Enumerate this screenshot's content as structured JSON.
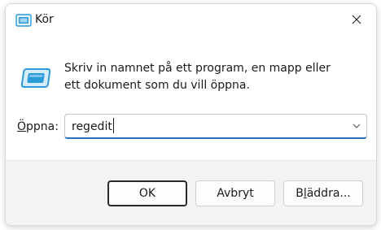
{
  "window": {
    "title": "Kör",
    "title_icon": "run-dialog-icon",
    "close_icon": "close-icon"
  },
  "body": {
    "icon": "run-program-icon",
    "description": "Skriv in namnet på ett program, en mapp eller ett dokument som du vill öppna.",
    "open_label_accel": "Ö",
    "open_label_rest": "ppna:",
    "open_value": "regedit"
  },
  "buttons": {
    "ok": "OK",
    "cancel": "Avbryt",
    "browse_accel": "B",
    "browse_underlined": "l",
    "browse_rest": "äddra..."
  },
  "colors": {
    "accent": "#2c6fbf",
    "icon_blue": "#2b9bd8",
    "footer_bg": "#f3f3f3"
  }
}
